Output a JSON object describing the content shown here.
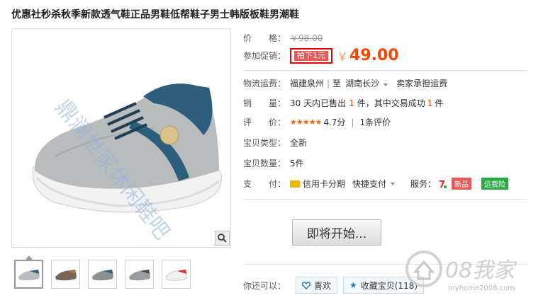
{
  "title": "优惠社秒杀秋季新款透气鞋正品男鞋低帮鞋子男士韩版板鞋男潮鞋",
  "watermark": "鼎澜世家休闲鞋吧",
  "price": {
    "label": "价　　格：",
    "original": "￥98.00"
  },
  "promo": {
    "label": "参加促销：",
    "tag": "拍下1元",
    "currency": "￥",
    "amount": "49.00"
  },
  "shipping": {
    "label": "物流运费：",
    "from": "福建泉州",
    "to_prefix": "至",
    "to": "湖南长沙",
    "fee": "卖家承担运费"
  },
  "sales": {
    "label": "销　　量：",
    "prefix": "30 天内已售出",
    "count": "1",
    "mid": "件，其中交易成功",
    "success": "1",
    "suffix": "件"
  },
  "rating": {
    "label": "评　　价：",
    "stars": "★★★★★",
    "score": "4.7分",
    "divider": "|",
    "reviews": "1条评价"
  },
  "condition": {
    "label": "宝贝类型：",
    "value": "全新"
  },
  "quantity": {
    "label": "宝贝数量：",
    "value": "5件"
  },
  "payment": {
    "label": "支　　付：",
    "credit": "信用卡分期",
    "quick": "快捷支付",
    "service_label": "服务：",
    "badge_new": "新品",
    "badge_ship": "运费险"
  },
  "actions": {
    "start_button": "即将开始...",
    "also_label": "你还可以：",
    "like": "喜欢",
    "fav": "收藏宝贝(118)"
  },
  "logo": {
    "text": "08我家",
    "url_text": "myhome2008.com"
  },
  "colors": {
    "accent": "#ff4400",
    "promo_border": "#ee0000",
    "badge_new": "#e85a5a",
    "badge_ship": "#2aa843"
  }
}
